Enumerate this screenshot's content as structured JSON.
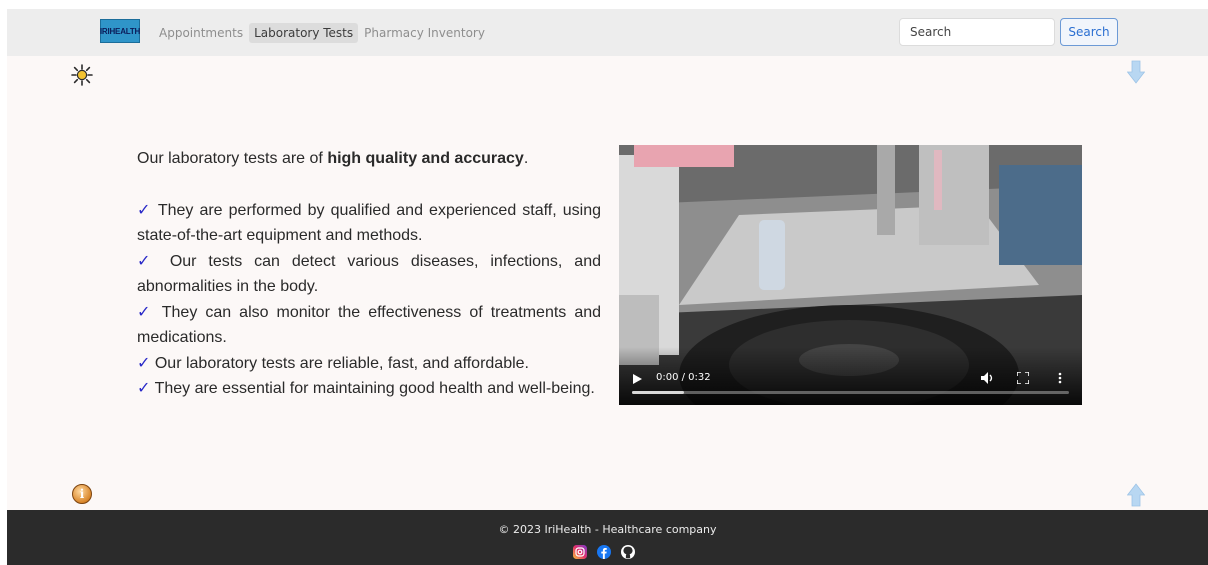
{
  "brand": {
    "logo_text": "IRIHEALTH"
  },
  "nav": {
    "links": [
      {
        "label": "Appointments",
        "active": false
      },
      {
        "label": "Laboratory Tests",
        "active": true
      },
      {
        "label": "Pharmacy Inventory",
        "active": false
      }
    ]
  },
  "search": {
    "placeholder": "Search",
    "button_label": "Search"
  },
  "main": {
    "intro_prefix": "Our laboratory tests are of ",
    "intro_bold": "high quality and accuracy",
    "intro_suffix": ".",
    "check_symbol": "✓",
    "points": [
      "They are performed by qualified and experienced staff, using state-of-the-art equipment and methods.",
      "Our tests can detect various diseases, infections, and abnormalities in the body.",
      "They can also monitor the effectiveness of treatments and medications.",
      "Our laboratory tests are reliable, fast, and affordable.",
      "They are essential for maintaining good health and well-being."
    ]
  },
  "video": {
    "time": "0:00 / 0:32",
    "progress_fraction": 0.12
  },
  "icons": {
    "theme": "sun-icon",
    "scroll_down": "arrow-down-icon",
    "scroll_up": "arrow-up-icon",
    "info": "info-icon"
  },
  "footer": {
    "copyright": "© 2023 IriHealth - Healthcare company",
    "socials": [
      "instagram-icon",
      "facebook-icon",
      "github-icon"
    ]
  },
  "colors": {
    "page_bg": "#fcf8f7",
    "navbar_bg": "#ededed",
    "footer_bg": "#2b2b2b",
    "check_color": "#2929c8",
    "search_button_border": "#6c9ad6"
  }
}
